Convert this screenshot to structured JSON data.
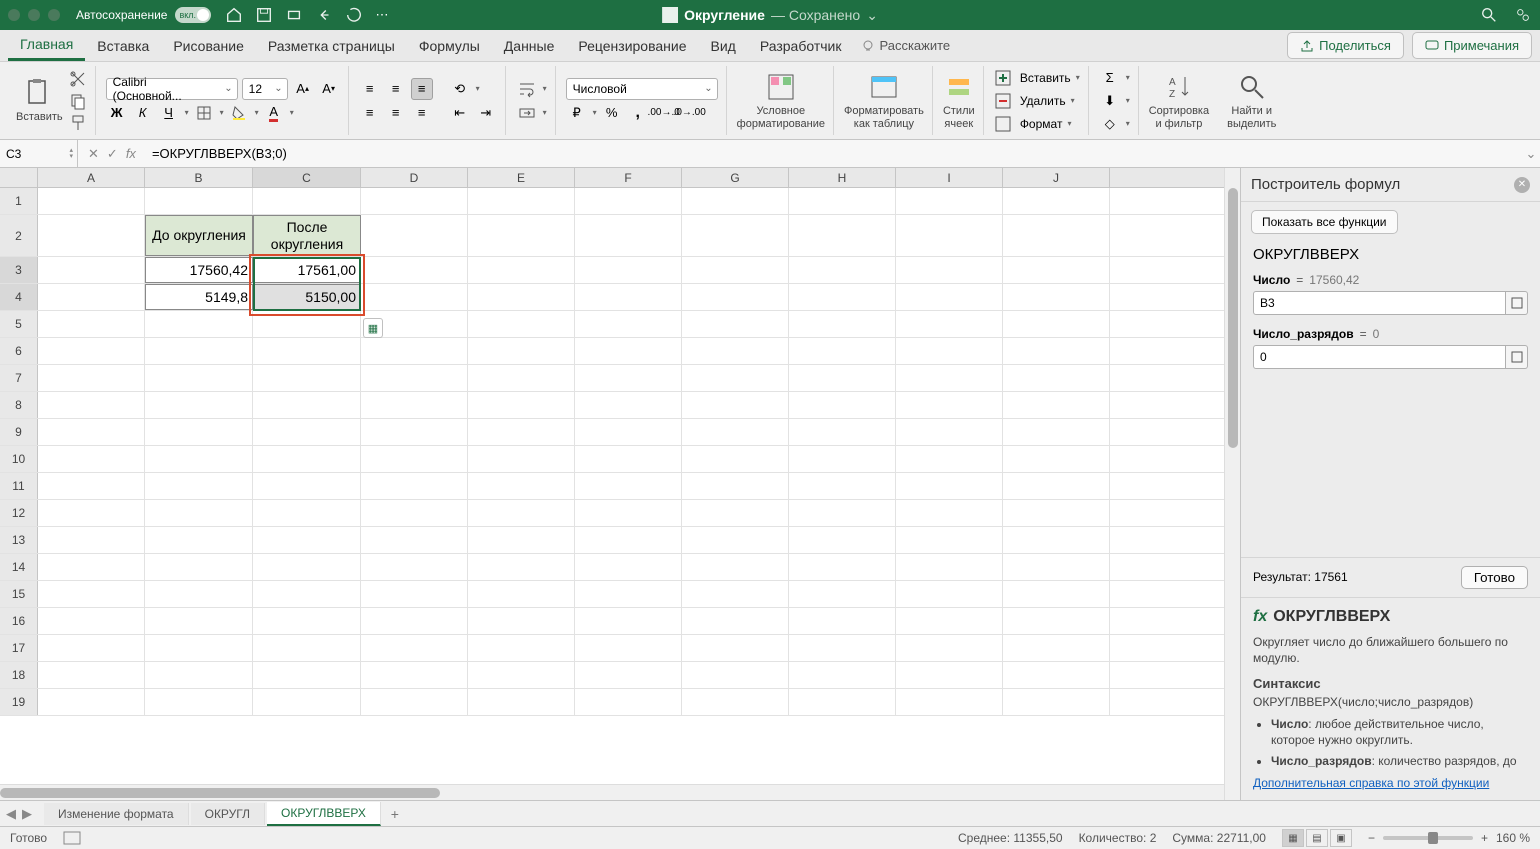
{
  "titlebar": {
    "autosave_label": "Автосохранение",
    "autosave_on": "вкл.",
    "doc_name": "Округление",
    "saved": "— Сохранено"
  },
  "tabs": {
    "home": "Главная",
    "insert": "Вставка",
    "draw": "Рисование",
    "layout": "Разметка страницы",
    "formulas": "Формулы",
    "data": "Данные",
    "review": "Рецензирование",
    "view": "Вид",
    "developer": "Разработчик",
    "tellme": "Расскажите",
    "share": "Поделиться",
    "comments": "Примечания"
  },
  "ribbon": {
    "paste": "Вставить",
    "font_name": "Calibri (Основной...",
    "font_size": "12",
    "number_format": "Числовой",
    "cond_fmt": "Условное\nформатирование",
    "fmt_table": "Форматировать\nкак таблицу",
    "cell_styles": "Стили\nячеек",
    "insert_cells": "Вставить",
    "delete_cells": "Удалить",
    "format_cells": "Формат",
    "sort_filter": "Сортировка\nи фильтр",
    "find_select": "Найти и\nвыделить"
  },
  "namebox": "C3",
  "formula": "=ОКРУГЛВВЕРХ(B3;0)",
  "columns": [
    "A",
    "B",
    "C",
    "D",
    "E",
    "F",
    "G",
    "H",
    "I",
    "J"
  ],
  "sheet": {
    "b2": "До округления",
    "c2": "После округления",
    "b3": "17560,42",
    "c3": "17561,00",
    "b4": "5149,8",
    "c4": "5150,00"
  },
  "panel": {
    "title": "Построитель формул",
    "show_all": "Показать все функции",
    "func": "ОКРУГЛВВЕРХ",
    "arg1_label": "Число",
    "arg1_computed": "17560,42",
    "arg1_value": "B3",
    "arg2_label": "Число_разрядов",
    "arg2_computed": "0",
    "arg2_value": "0",
    "result_label": "Результат:",
    "result_value": "17561",
    "done": "Готово",
    "help_desc": "Округляет число до ближайшего большего по модулю.",
    "syntax_h": "Синтаксис",
    "syntax": "ОКРУГЛВВЕРХ(число;число_разрядов)",
    "arg1_help_name": "Число",
    "arg1_help": ": любое действительное число, которое нужно округлить.",
    "arg2_help_name": "Число_разрядов",
    "arg2_help": ": количество разрядов, до",
    "more_help": "Дополнительная справка по этой функции"
  },
  "sheets": {
    "s1": "Изменение формата",
    "s2": "ОКРУГЛ",
    "s3": "ОКРУГЛВВЕРХ"
  },
  "status": {
    "ready": "Готово",
    "avg_label": "Среднее:",
    "avg_val": "11355,50",
    "count_label": "Количество:",
    "count_val": "2",
    "sum_label": "Сумма:",
    "sum_val": "22711,00",
    "zoom": "160 %"
  }
}
